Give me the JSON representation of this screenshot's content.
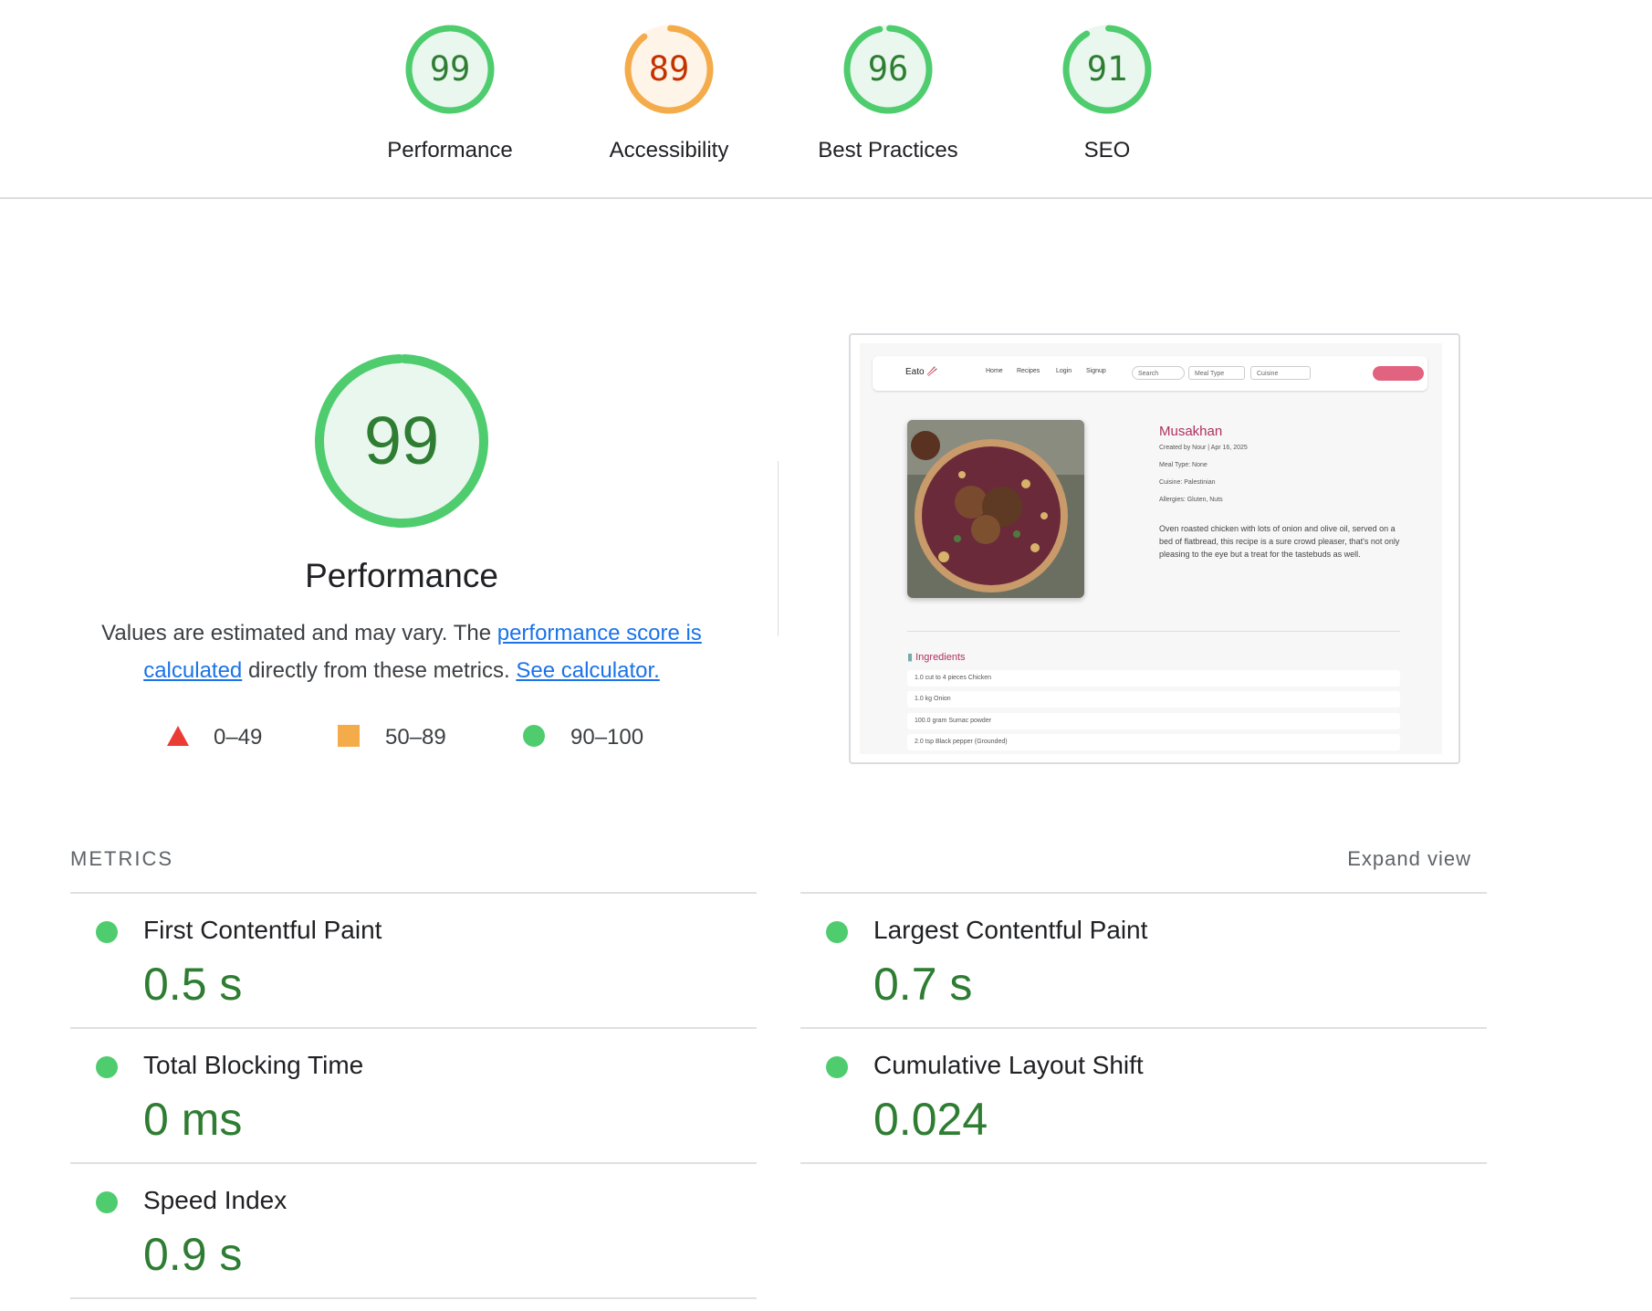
{
  "colors": {
    "pass": "#0cce6b",
    "pass_text": "#2e7d32",
    "average": "#ffa400",
    "average_text": "#c33300",
    "fail": "#ff4e42",
    "link": "#1a73e8"
  },
  "categories": [
    {
      "label": "Performance",
      "score": "99",
      "score_fraction": 0.99,
      "rating": "pass"
    },
    {
      "label": "Accessibility",
      "score": "89",
      "score_fraction": 0.89,
      "rating": "average"
    },
    {
      "label": "Best Practices",
      "score": "96",
      "score_fraction": 0.96,
      "rating": "pass"
    },
    {
      "label": "SEO",
      "score": "91",
      "score_fraction": 0.91,
      "rating": "pass"
    }
  ],
  "performance": {
    "score": "99",
    "score_fraction": 0.99,
    "title": "Performance",
    "desc_prefix": "Values are estimated and may vary. The ",
    "link1": "performance score is calculated",
    "desc_middle": " directly from these metrics. ",
    "link2": "See calculator."
  },
  "legend": [
    {
      "icon": "triangle-icon",
      "range": "0–49"
    },
    {
      "icon": "square-icon",
      "range": "50–89"
    },
    {
      "icon": "circle-icon",
      "range": "90–100"
    }
  ],
  "screenshot": {
    "logo": "Eato 🥢",
    "nav": [
      "Home",
      "Recipes",
      "Login",
      "Signup"
    ],
    "search_placeholder": "Search",
    "meal_type": "Meal Type",
    "cuisine": "Cuisine",
    "recipe_title": "Musakhan",
    "meta": "Created by Nour | Apr 16, 2025",
    "meal_type_line": "Meal Type: None",
    "cuisine_line": "Cuisine: Palestinian",
    "allergies_line": "Allergies: Gluten, Nuts",
    "description": "Oven roasted chicken with lots of onion and olive oil, served on a bed of flatbread, this recipe is a sure crowd pleaser, that's not only pleasing to the eye but a treat for the tastebuds as well.",
    "ingredients_title": "Ingredients",
    "ingredients": [
      "1.0 cut to 4 pieces Chicken",
      "1.0 kg Onion",
      "100.0 gram Sumac powder",
      "2.0 tsp Black pepper (Grounded)"
    ]
  },
  "metrics": {
    "header": "METRICS",
    "expand": "Expand view",
    "items": [
      {
        "label": "First Contentful Paint",
        "value": "0.5 s"
      },
      {
        "label": "Largest Contentful Paint",
        "value": "0.7 s"
      },
      {
        "label": "Total Blocking Time",
        "value": "0 ms"
      },
      {
        "label": "Cumulative Layout Shift",
        "value": "0.024"
      },
      {
        "label": "Speed Index",
        "value": "0.9 s"
      }
    ]
  }
}
